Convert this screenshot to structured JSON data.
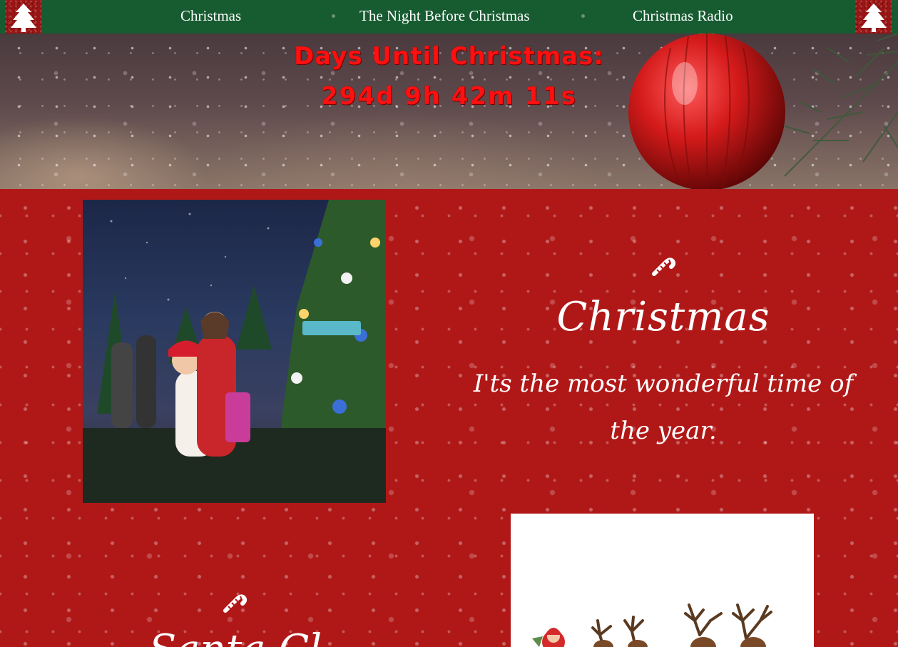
{
  "nav": {
    "links": [
      "Christmas",
      "The Night Before Christmas",
      "Christmas Radio"
    ],
    "left_icon": "christmas-tree-icon",
    "right_icon": "christmas-tree-icon",
    "background_color": "#175b31"
  },
  "hero": {
    "countdown_title": "Days Until Christmas:",
    "countdown_value": "294d 9h 42m 11s",
    "countdown_color": "#ff1010"
  },
  "section1": {
    "icon": "candy-cane-icon",
    "title": "Christmas",
    "text": "I'ts the most wonderful time of the year."
  },
  "section2": {
    "icon": "candy-cane-icon",
    "title": "Santa Cl"
  },
  "theme": {
    "content_background": "#b01818",
    "text_color": "#ffffff"
  }
}
